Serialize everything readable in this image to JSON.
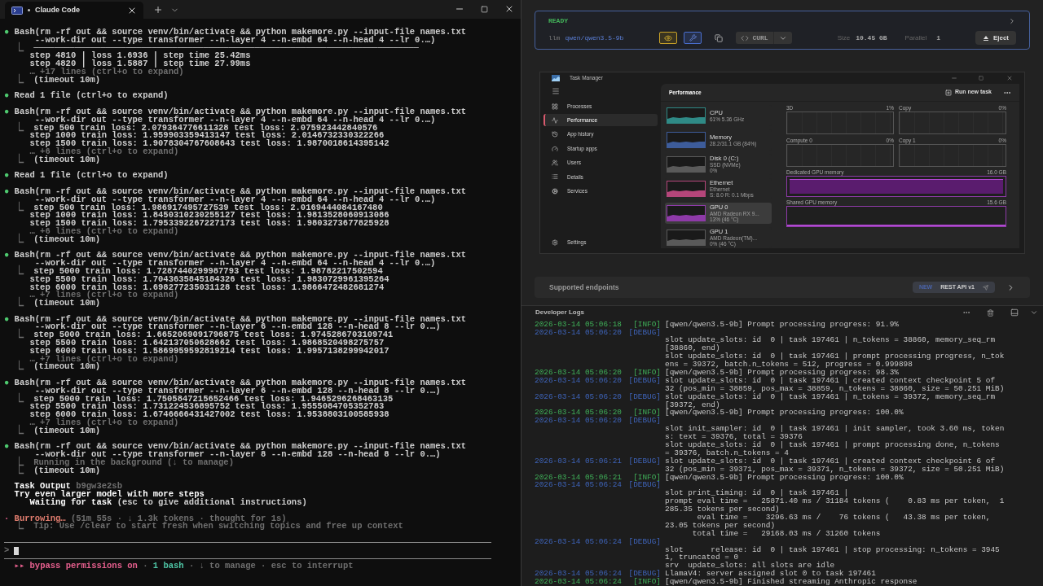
{
  "terminal": {
    "tab": {
      "title": "Claude Code",
      "busy": true
    },
    "lines": [
      {
        "kind": "text",
        "segments": [
          {
            "text": "●",
            "kind": "bullet"
          },
          {
            "text": " Bash(rm -rf out && source venv/bin/activate && python makemore.py --input-file names.txt",
            "kind": "plain"
          }
        ]
      },
      {
        "kind": "text",
        "segments": [
          {
            "text": "      --work-dir out --type transformer --n-layer 4 --n-embd 64 --n-head 4 --lr 0.…)",
            "kind": "plain"
          }
        ]
      },
      {
        "kind": "text",
        "segments": [
          {
            "text": "  ⎿  ",
            "kind": "dim"
          },
          {
            "text": "───────────────────────────────────────────────────────────────────────────",
            "kind": "plain"
          }
        ]
      },
      {
        "kind": "text",
        "segments": [
          {
            "text": "     step 4810 | loss 1.6936 | step time 25.42ms",
            "kind": "plain"
          }
        ]
      },
      {
        "kind": "text",
        "segments": [
          {
            "text": "     step 4820 | loss 1.5887 | step time 27.99ms",
            "kind": "plain"
          }
        ]
      },
      {
        "kind": "text",
        "segments": [
          {
            "text": "     … +17 lines (ctrl+o to expand)",
            "kind": "dim"
          }
        ]
      },
      {
        "kind": "text",
        "segments": [
          {
            "text": "  ⎿  ",
            "kind": "dim"
          },
          {
            "text": "(timeout 10m)",
            "kind": "plain"
          }
        ]
      },
      {
        "kind": "blank"
      },
      {
        "kind": "text",
        "segments": [
          {
            "text": "●",
            "kind": "bullet"
          },
          {
            "text": " Read 1 file (ctrl+o to expand)",
            "kind": "plain"
          }
        ]
      },
      {
        "kind": "blank"
      },
      {
        "kind": "text",
        "segments": [
          {
            "text": "●",
            "kind": "bullet"
          },
          {
            "text": " Bash(rm -rf out && source venv/bin/activate && python makemore.py --input-file names.txt",
            "kind": "plain"
          }
        ]
      },
      {
        "kind": "text",
        "segments": [
          {
            "text": "      --work-dir out --type transformer --n-layer 4 --n-embd 64 --n-head 4 --lr 0.…)",
            "kind": "plain"
          }
        ]
      },
      {
        "kind": "text",
        "segments": [
          {
            "text": "  ⎿  ",
            "kind": "dim"
          },
          {
            "text": "step 500 train loss: 2.079364776611328 test loss: 2.075923442840576",
            "kind": "plain"
          }
        ]
      },
      {
        "kind": "text",
        "segments": [
          {
            "text": "     step 1000 train loss: 1.959903359413147 test loss: 2.0146732330322266",
            "kind": "plain"
          }
        ]
      },
      {
        "kind": "text",
        "segments": [
          {
            "text": "     step 1500 train loss: 1.9078304767608643 test loss: 1.9870018614395142",
            "kind": "plain"
          }
        ]
      },
      {
        "kind": "text",
        "segments": [
          {
            "text": "     … +6 lines (ctrl+o to expand)",
            "kind": "dim"
          }
        ]
      },
      {
        "kind": "text",
        "segments": [
          {
            "text": "  ⎿  ",
            "kind": "dim"
          },
          {
            "text": "(timeout 10m)",
            "kind": "plain"
          }
        ]
      },
      {
        "kind": "blank"
      },
      {
        "kind": "text",
        "segments": [
          {
            "text": "●",
            "kind": "bullet"
          },
          {
            "text": " Read 1 file (ctrl+o to expand)",
            "kind": "plain"
          }
        ]
      },
      {
        "kind": "blank"
      },
      {
        "kind": "text",
        "segments": [
          {
            "text": "●",
            "kind": "bullet"
          },
          {
            "text": " Bash(rm -rf out && source venv/bin/activate && python makemore.py --input-file names.txt",
            "kind": "plain"
          }
        ]
      },
      {
        "kind": "text",
        "segments": [
          {
            "text": "      --work-dir out --type transformer --n-layer 4 --n-embd 64 --n-head 4 --lr 0.…)",
            "kind": "plain"
          }
        ]
      },
      {
        "kind": "text",
        "segments": [
          {
            "text": "  ⎿  ",
            "kind": "dim"
          },
          {
            "text": "step 500 train loss: 1.986917495727539 test loss: 2.0169444084167480",
            "kind": "plain"
          }
        ]
      },
      {
        "kind": "text",
        "segments": [
          {
            "text": "     step 1000 train loss: 1.8450310230255127 test loss: 1.9813528060913086",
            "kind": "plain"
          }
        ]
      },
      {
        "kind": "text",
        "segments": [
          {
            "text": "     step 1500 train loss: 1.7953392267227173 test loss: 1.9803273677825928",
            "kind": "plain"
          }
        ]
      },
      {
        "kind": "text",
        "segments": [
          {
            "text": "     … +6 lines (ctrl+o to expand)",
            "kind": "dim"
          }
        ]
      },
      {
        "kind": "text",
        "segments": [
          {
            "text": "  ⎿  ",
            "kind": "dim"
          },
          {
            "text": "(timeout 10m)",
            "kind": "plain"
          }
        ]
      },
      {
        "kind": "blank"
      },
      {
        "kind": "text",
        "segments": [
          {
            "text": "●",
            "kind": "bullet"
          },
          {
            "text": " Bash(rm -rf out && source venv/bin/activate && python makemore.py --input-file names.txt",
            "kind": "plain"
          }
        ]
      },
      {
        "kind": "text",
        "segments": [
          {
            "text": "      --work-dir out --type transformer --n-layer 4 --n-embd 64 --n-head 4 --lr 0.…)",
            "kind": "plain"
          }
        ]
      },
      {
        "kind": "text",
        "segments": [
          {
            "text": "  ⎿  ",
            "kind": "dim"
          },
          {
            "text": "step 5000 train loss: 1.7287440299987793 test loss: 1.98782217502594",
            "kind": "plain"
          }
        ]
      },
      {
        "kind": "text",
        "segments": [
          {
            "text": "     step 5500 train loss: 1.7043635845184326 test loss: 1.9830729961395264",
            "kind": "plain"
          }
        ]
      },
      {
        "kind": "text",
        "segments": [
          {
            "text": "     step 6000 train loss: 1.698277235031128 test loss: 1.9866472482681274",
            "kind": "plain"
          }
        ]
      },
      {
        "kind": "text",
        "segments": [
          {
            "text": "     … +7 lines (ctrl+o to expand)",
            "kind": "dim"
          }
        ]
      },
      {
        "kind": "text",
        "segments": [
          {
            "text": "  ⎿  ",
            "kind": "dim"
          },
          {
            "text": "(timeout 10m)",
            "kind": "plain"
          }
        ]
      },
      {
        "kind": "blank"
      },
      {
        "kind": "text",
        "segments": [
          {
            "text": "●",
            "kind": "bullet"
          },
          {
            "text": " Bash(rm -rf out && source venv/bin/activate && python makemore.py --input-file names.txt",
            "kind": "plain"
          }
        ]
      },
      {
        "kind": "text",
        "segments": [
          {
            "text": "      --work-dir out --type transformer --n-layer 6 --n-embd 128 --n-head 8 --lr 0.…)",
            "kind": "plain"
          }
        ]
      },
      {
        "kind": "text",
        "segments": [
          {
            "text": "  ⎿  ",
            "kind": "dim"
          },
          {
            "text": "step 5000 train loss: 1.6652069091796875 test loss: 1.9745286703109741",
            "kind": "plain"
          }
        ]
      },
      {
        "kind": "text",
        "segments": [
          {
            "text": "     step 5500 train loss: 1.642137050628662 test loss: 1.9868520498275757",
            "kind": "plain"
          }
        ]
      },
      {
        "kind": "text",
        "segments": [
          {
            "text": "     step 6000 train loss: 1.5869959592819214 test loss: 1.9957138299942017",
            "kind": "plain"
          }
        ]
      },
      {
        "kind": "text",
        "segments": [
          {
            "text": "     … +7 lines (ctrl+o to expand)",
            "kind": "dim"
          }
        ]
      },
      {
        "kind": "text",
        "segments": [
          {
            "text": "  ⎿  ",
            "kind": "dim"
          },
          {
            "text": "(timeout 10m)",
            "kind": "plain"
          }
        ]
      },
      {
        "kind": "blank"
      },
      {
        "kind": "text",
        "segments": [
          {
            "text": "●",
            "kind": "bullet"
          },
          {
            "text": " Bash(rm -rf out && source venv/bin/activate && python makemore.py --input-file names.txt",
            "kind": "plain"
          }
        ]
      },
      {
        "kind": "text",
        "segments": [
          {
            "text": "      --work-dir out --type transformer --n-layer 6 --n-embd 128 --n-head 8 --lr 0.…)",
            "kind": "plain"
          }
        ]
      },
      {
        "kind": "text",
        "segments": [
          {
            "text": "  ⎿  ",
            "kind": "dim"
          },
          {
            "text": "step 5000 train loss: 1.7505847215652466 test loss: 1.9465296268463135",
            "kind": "plain"
          }
        ]
      },
      {
        "kind": "text",
        "segments": [
          {
            "text": "     step 5500 train loss: 1.731224536895752 test loss: 1.9555084705352783",
            "kind": "plain"
          }
        ]
      },
      {
        "kind": "text",
        "segments": [
          {
            "text": "     step 6000 train loss: 1.6746666431427002 test loss: 1.9538803100585938",
            "kind": "plain"
          }
        ]
      },
      {
        "kind": "text",
        "segments": [
          {
            "text": "     … +7 lines (ctrl+o to expand)",
            "kind": "dim"
          }
        ]
      },
      {
        "kind": "text",
        "segments": [
          {
            "text": "  ⎿  ",
            "kind": "dim"
          },
          {
            "text": "(timeout 10m)",
            "kind": "plain"
          }
        ]
      },
      {
        "kind": "blank"
      },
      {
        "kind": "text",
        "segments": [
          {
            "text": "●",
            "kind": "bullet"
          },
          {
            "text": " Bash(rm -rf out && source venv/bin/activate && python makemore.py --input-file names.txt",
            "kind": "plain"
          }
        ]
      },
      {
        "kind": "text",
        "segments": [
          {
            "text": "      --work-dir out --type transformer --n-layer 8 --n-embd 128 --n-head 8 --lr 0.…)",
            "kind": "plain"
          }
        ]
      },
      {
        "kind": "text",
        "segments": [
          {
            "text": "  ⎿  ",
            "kind": "dim"
          },
          {
            "text": "Running in the background (↓ to manage)",
            "kind": "dim"
          }
        ]
      },
      {
        "kind": "text",
        "segments": [
          {
            "text": "  ⎿  ",
            "kind": "dim"
          },
          {
            "text": "(timeout 10m)",
            "kind": "plain"
          }
        ]
      },
      {
        "kind": "blank"
      },
      {
        "kind": "text",
        "segments": [
          {
            "text": "  Task Output ",
            "kind": "strong"
          },
          {
            "text": "b9gw3e2sb",
            "kind": "dim"
          }
        ]
      },
      {
        "kind": "text",
        "segments": [
          {
            "text": "  Try even larger model with more steps",
            "kind": "strong"
          }
        ]
      },
      {
        "kind": "text",
        "segments": [
          {
            "text": "     Waiting for task ",
            "kind": "strong"
          },
          {
            "text": "(esc to give additional instructions)",
            "kind": "plain"
          }
        ]
      },
      {
        "kind": "blank"
      },
      {
        "kind": "text",
        "segments": [
          {
            "text": "·",
            "kind": "pink"
          },
          {
            "text": " Burrowing… ",
            "kind": "warn"
          },
          {
            "text": "(51m 55s · ↓ 1.3k tokens · thought for 1s)",
            "kind": "dim"
          }
        ]
      },
      {
        "kind": "text",
        "segments": [
          {
            "text": "  ⎿  Tip: Use /clear to start fresh when switching topics and free up context",
            "kind": "dim"
          }
        ]
      },
      {
        "kind": "blank"
      },
      {
        "kind": "rule"
      },
      {
        "kind": "prompt",
        "segments": [
          {
            "text": ">",
            "kind": "dim"
          }
        ]
      },
      {
        "kind": "rule"
      },
      {
        "kind": "text",
        "segments": [
          {
            "text": "  ▸▸ bypass permissions on",
            "kind": "pink"
          },
          {
            "text": " · ",
            "kind": "dim"
          },
          {
            "text": "1 bash",
            "kind": "teal"
          },
          {
            "text": " · ↓ to manage · esc to interrupt",
            "kind": "dim"
          }
        ]
      }
    ]
  },
  "model_card": {
    "status": "READY",
    "type": "llm",
    "model": "qwen/qwen3.5-9b",
    "capabilities": [
      {
        "kind": "vision"
      },
      {
        "kind": "tools"
      }
    ],
    "curl": "CURL",
    "size_label": "Size",
    "size": "10.45 GB",
    "parallel_label": "Parallel",
    "parallel": "1",
    "eject": "Eject"
  },
  "task_manager": {
    "title": "Task Manager",
    "nav": [
      {
        "kind": "processes",
        "label": "Processes",
        "selected": false
      },
      {
        "kind": "performance",
        "label": "Performance",
        "selected": true
      },
      {
        "kind": "history",
        "label": "App history",
        "selected": false
      },
      {
        "kind": "startup",
        "label": "Startup apps",
        "selected": false
      },
      {
        "kind": "users",
        "label": "Users",
        "selected": false
      },
      {
        "kind": "details",
        "label": "Details",
        "selected": false
      },
      {
        "kind": "services",
        "label": "Services",
        "selected": false
      }
    ],
    "settings": "Settings",
    "heading": "Performance",
    "run_task": "Run new task",
    "devices": [
      {
        "name": "CPU",
        "details": [
          "61% 5.36 GHz"
        ],
        "color": "#2f8a86",
        "selected": false
      },
      {
        "name": "Memory",
        "details": [
          "28.2/31.1 GB (84%)"
        ],
        "color": "#3d5c9a",
        "selected": false
      },
      {
        "name": "Disk 0 (C:)",
        "details": [
          "SSD (NVMe)",
          "0%"
        ],
        "color": "#5a5a5a",
        "selected": false
      },
      {
        "name": "Ethernet",
        "details": [
          "Ethernet",
          "S: 8.0 R: 0.1 Mbps"
        ],
        "color": "#b5467a",
        "selected": false
      },
      {
        "name": "GPU 0",
        "details": [
          "AMD Radeon RX 9...",
          "13% (46 °C)"
        ],
        "color": "#8e3aa8",
        "selected": true
      },
      {
        "name": "GPU 1",
        "details": [
          "AMD Radeon(TM)...",
          "0% (46 °C)"
        ],
        "color": "#5a5a5a",
        "selected": false
      }
    ],
    "engines": [
      {
        "label": "3D",
        "value": "1%"
      },
      {
        "label": "Copy",
        "value": "0%"
      },
      {
        "label": "Compute 0",
        "value": "0%"
      },
      {
        "label": "Copy 1",
        "value": "0%"
      }
    ],
    "memory": [
      {
        "label": "Dedicated GPU memory",
        "value": "16.0 GB",
        "kind": "full"
      },
      {
        "label": "Shared GPU memory",
        "value": "15.6 GB",
        "kind": "low"
      }
    ]
  },
  "endpoints": {
    "title": "Supported endpoints",
    "badge": "NEW",
    "label": "REST API v1"
  },
  "logs": {
    "title": "Developer Logs",
    "entries": [
      {
        "time": "2026-03-14 05:06:18",
        "tag": "[INFO]",
        "kind": "info",
        "inline": true,
        "lines": [
          "[qwen/qwen3.5-9b] Prompt processing progress: 91.9%"
        ]
      },
      {
        "time": "2026-03-14 05:06:20",
        "tag": "[DEBUG]",
        "kind": "debug",
        "inline": false,
        "lines": [
          "slot update_slots: id  0 | task 197461 | n_tokens = 38860, memory_seq_rm",
          "[38860, end)",
          "slot update_slots: id  0 | task 197461 | prompt processing progress, n_tok",
          "ens = 39372, batch.n_tokens = 512, progress = 0.999898"
        ]
      },
      {
        "time": "2026-03-14 05:06:20",
        "tag": "[INFO]",
        "kind": "info",
        "inline": true,
        "lines": [
          "[qwen/qwen3.5-9b] Prompt processing progress: 98.3%"
        ]
      },
      {
        "time": "2026-03-14 05:06:20",
        "tag": "[DEBUG]",
        "kind": "debug",
        "inline": true,
        "lines": [
          "slot update_slots: id  0 | task 197461 | created context checkpoint 5 of",
          "32 (pos_min = 38859, pos_max = 38859, n_tokens = 38860, size = 50.251 MiB)"
        ]
      },
      {
        "time": "2026-03-14 05:06:20",
        "tag": "[DEBUG]",
        "kind": "debug",
        "inline": true,
        "lines": [
          "slot update_slots: id  0 | task 197461 | n_tokens = 39372, memory_seq_rm",
          "[39372, end)"
        ]
      },
      {
        "time": "2026-03-14 05:06:20",
        "tag": "[INFO]",
        "kind": "info",
        "inline": true,
        "lines": [
          "[qwen/qwen3.5-9b] Prompt processing progress: 100.0%"
        ]
      },
      {
        "time": "2026-03-14 05:06:20",
        "tag": "[DEBUG]",
        "kind": "debug",
        "inline": false,
        "lines": [
          "slot init_sampler: id  0 | task 197461 | init sampler, took 3.60 ms, token",
          "s: text = 39376, total = 39376",
          "slot update_slots: id  0 | task 197461 | prompt processing done, n_tokens",
          "= 39376, batch.n_tokens = 4"
        ]
      },
      {
        "time": "2026-03-14 05:06:21",
        "tag": "[DEBUG]",
        "kind": "debug",
        "inline": true,
        "lines": [
          "slot update_slots: id  0 | task 197461 | created context checkpoint 6 of",
          "32 (pos_min = 39371, pos_max = 39371, n_tokens = 39372, size = 50.251 MiB)"
        ]
      },
      {
        "time": "2026-03-14 05:06:21",
        "tag": "[INFO]",
        "kind": "info",
        "inline": true,
        "lines": [
          "[qwen/qwen3.5-9b] Prompt processing progress: 100.0%"
        ]
      },
      {
        "time": "2026-03-14 05:06:24",
        "tag": "[DEBUG]",
        "kind": "debug",
        "inline": false,
        "lines": [
          "slot print_timing: id  0 | task 197461 |",
          "prompt eval time =   25871.40 ms / 31184 tokens (    0.83 ms per token,  1",
          "285.35 tokens per second)",
          "       eval time =    3296.63 ms /    76 tokens (   43.38 ms per token,",
          "23.05 tokens per second)",
          "      total time =   29168.03 ms / 31260 tokens"
        ]
      },
      {
        "time": "2026-03-14 05:06:24",
        "tag": "[DEBUG]",
        "kind": "debug",
        "inline": false,
        "lines": [
          "slot      release: id  0 | task 197461 | stop processing: n_tokens = 3945",
          "1, truncated = 0",
          "srv  update_slots: all slots are idle"
        ]
      },
      {
        "time": "2026-03-14 05:06:24",
        "tag": "[DEBUG]",
        "kind": "debug",
        "inline": true,
        "lines": [
          "LlamaV4: server assigned slot 0 to task 197461"
        ]
      },
      {
        "time": "2026-03-14 05:06:24",
        "tag": "[INFO]",
        "kind": "info",
        "inline": true,
        "lines": [
          "[qwen/qwen3.5-9b] Finished streaming Anthropic response"
        ]
      }
    ]
  }
}
